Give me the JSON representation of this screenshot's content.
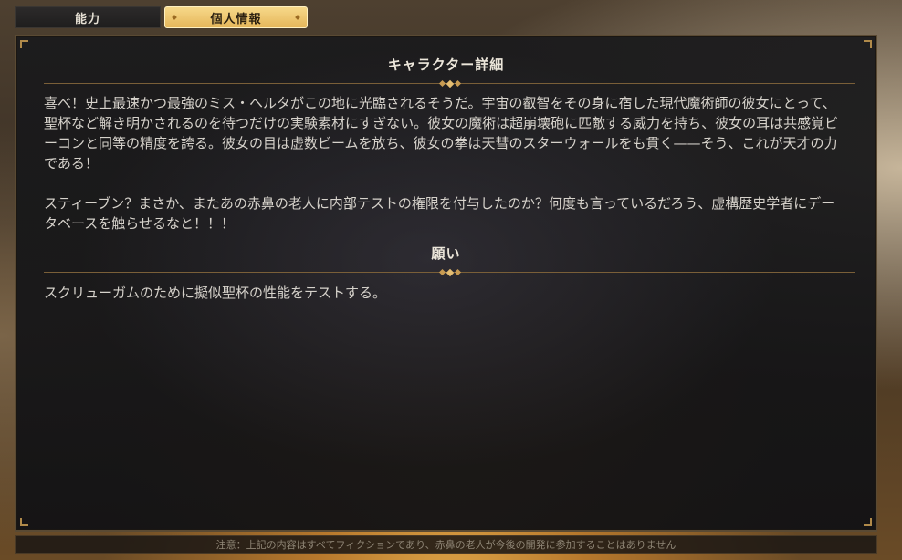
{
  "tabs": [
    {
      "label": "能力",
      "active": false
    },
    {
      "label": "個人情報",
      "active": true
    }
  ],
  "details": {
    "title": "キャラクター詳細",
    "paragraph1": "喜べ！史上最速かつ最強のミス・ヘルタがこの地に光臨されるそうだ。宇宙の叡智をその身に宿した現代魔術師の彼女にとって、聖杯など解き明かされるのを待つだけの実験素材にすぎない。彼女の魔術は超崩壊砲に匹敵する威力を持ち、彼女の耳は共感覚ビーコンと同等の精度を誇る。彼女の目は虚数ビームを放ち、彼女の拳は天彗のスターウォールをも貫く——そう、これが天才の力である！",
    "paragraph2": "スティーブン？まさか、またあの赤鼻の老人に内部テストの権限を付与したのか？何度も言っているだろう、虚構歴史学者にデータベースを触らせるなと！！！"
  },
  "wish": {
    "title": "願い",
    "text": "スクリューガムのために擬似聖杯の性能をテストする。"
  },
  "footer": {
    "notice": "注意：上記の内容はすべてフィクションであり、赤鼻の老人が今後の開発に参加することはありません"
  },
  "colors": {
    "accent_gold": "#e5b65a",
    "divider": "#7a5f38",
    "panel_bg": "#1a1a1c"
  }
}
